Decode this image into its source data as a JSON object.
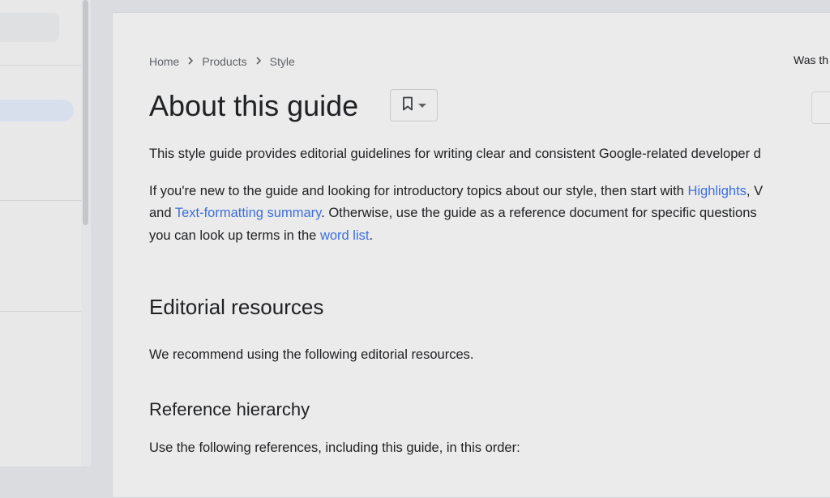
{
  "breadcrumb": {
    "home": "Home",
    "products": "Products",
    "style": "Style",
    "separator": "›"
  },
  "feedback": {
    "label": "Was th"
  },
  "page": {
    "title": "About this guide"
  },
  "intro": {
    "text": "This style guide provides editorial guidelines for writing clear and consistent Google-related developer d"
  },
  "newcomers": {
    "line1_text": "If you're new to the guide and looking for introductory topics about our style, then start with ",
    "link_highlights": "Highlights",
    "line1_tail": ", V",
    "line2_prefix": "and ",
    "link_text_formatting": "Text-formatting summary",
    "line2_tail": ". Otherwise, use the guide as a reference document for specific questions",
    "line3_prefix": "you can look up terms in the ",
    "link_word_list": "word list",
    "line3_tail": "."
  },
  "editorial": {
    "heading": "Editorial resources",
    "text": "We recommend using the following editorial resources."
  },
  "hierarchy": {
    "heading": "Reference hierarchy",
    "text": "Use the following references, including this guide, in this order:"
  },
  "colors": {
    "link": "#3d6fd9",
    "text": "#202124",
    "muted": "#5f6368",
    "active_nav": "#d8dfec"
  },
  "icons": {
    "bookmark": "bookmark-icon",
    "dropdown": "caret-down-icon",
    "breadcrumb_separator": "chevron-right-icon"
  }
}
